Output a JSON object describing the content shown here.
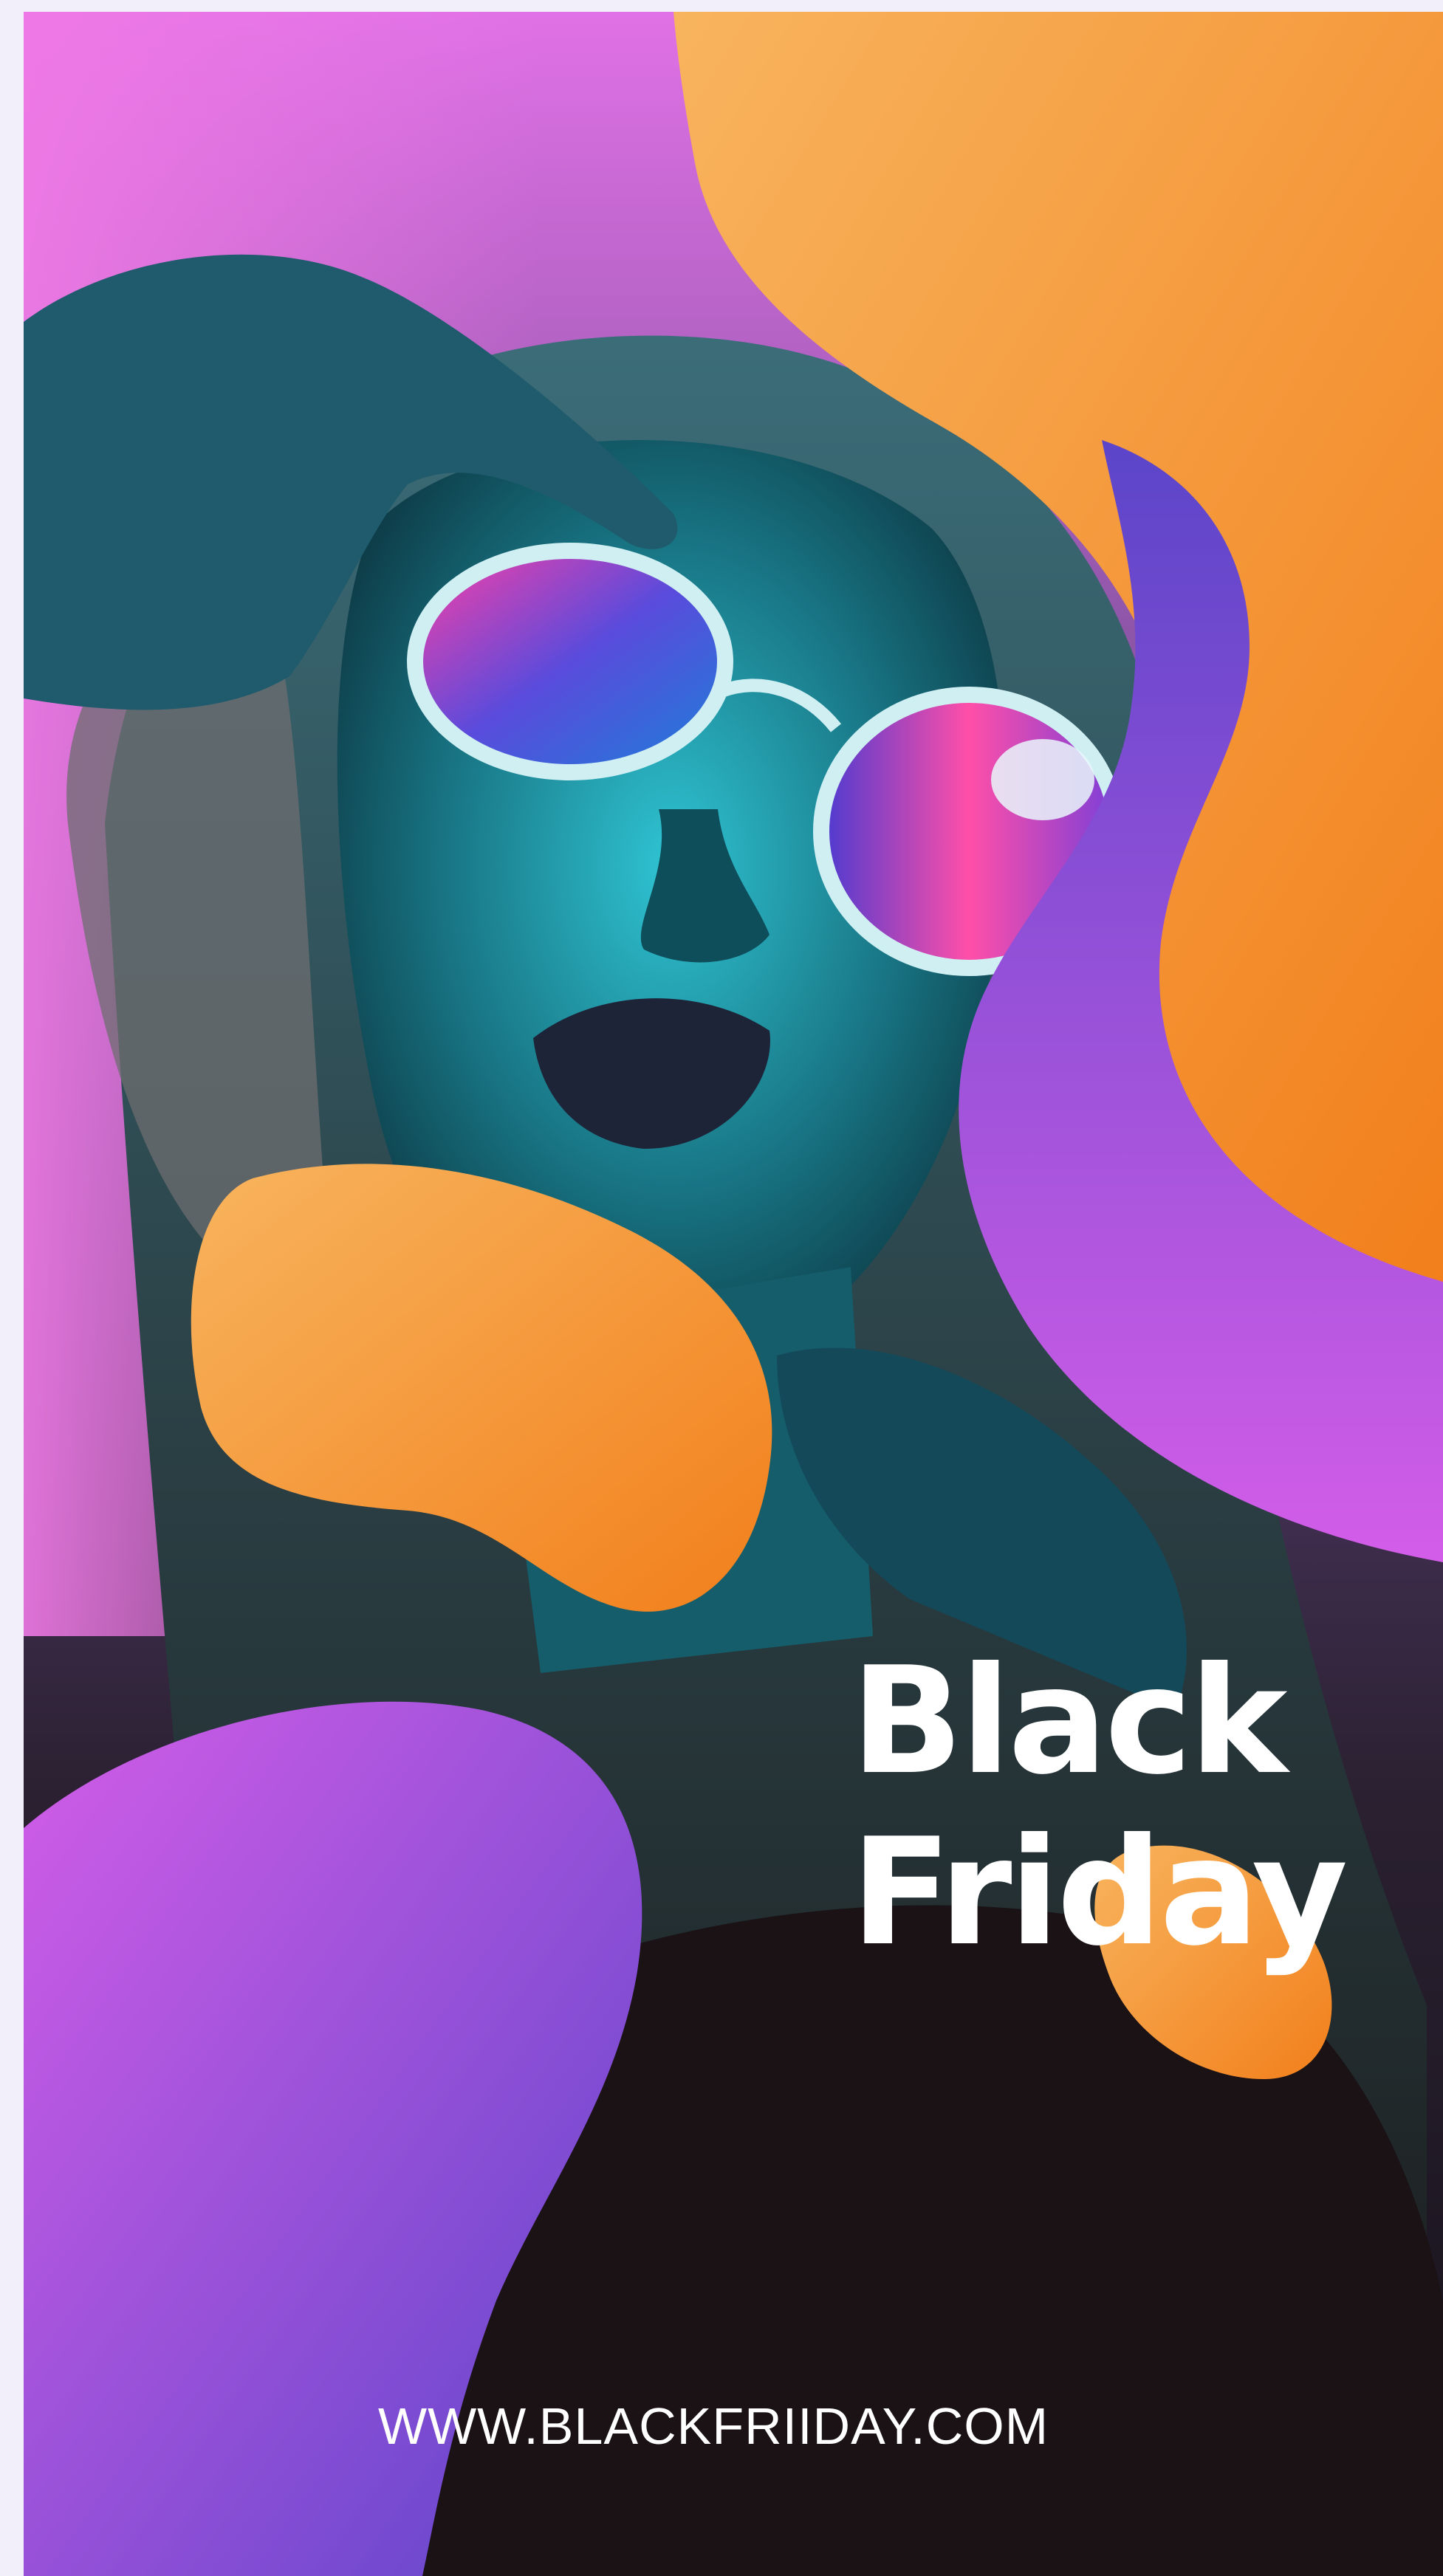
{
  "poster": {
    "headline_line1": "Black",
    "headline_line2": "Friday",
    "website": "WWW.BLACKFRIIDAY.COM"
  },
  "colors": {
    "orange_light": "#f8b45e",
    "orange_dark": "#f27f1b",
    "purple": "#b54fe6",
    "purple_dark": "#5b45c9",
    "magenta": "#d35de8",
    "teal": "#1fb6c7",
    "text": "#ffffff"
  },
  "icons": {
    "photo": "portrait-photo-icon"
  }
}
